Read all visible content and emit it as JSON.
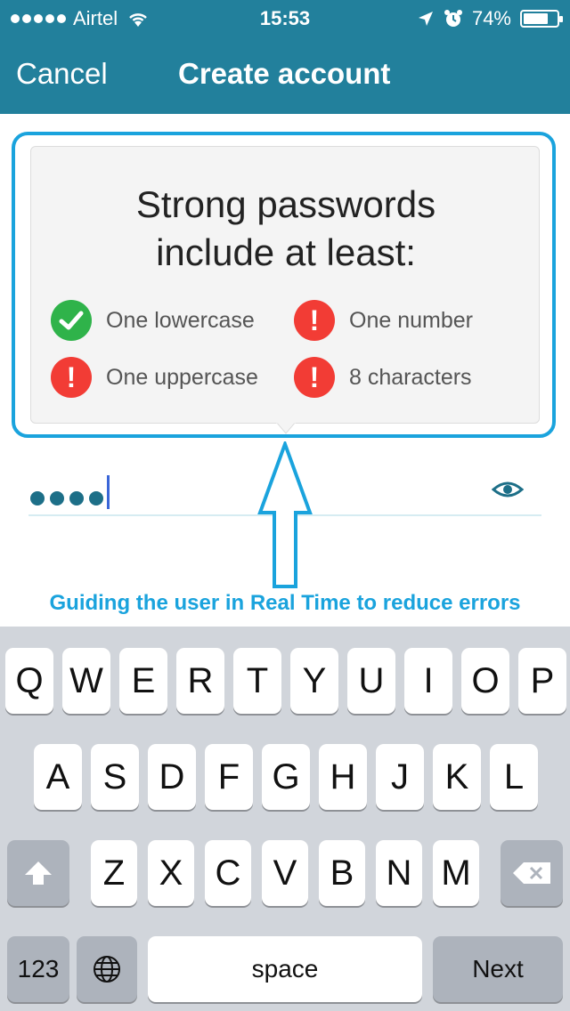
{
  "status_bar": {
    "carrier": "Airtel",
    "time": "15:53",
    "battery": "74%",
    "battery_level": 0.74,
    "icons": [
      "signal-dots-icon",
      "wifi-icon",
      "location-arrow-icon",
      "alarm-icon",
      "battery-icon"
    ]
  },
  "nav": {
    "cancel": "Cancel",
    "title": "Create account"
  },
  "password_tip": {
    "title_line1": "Strong passwords",
    "title_line2": "include at least:",
    "requirements": [
      {
        "label": "One lowercase",
        "met": true
      },
      {
        "label": "One number",
        "met": false
      },
      {
        "label": "One uppercase",
        "met": false
      },
      {
        "label": "8 characters",
        "met": false
      }
    ]
  },
  "password_field": {
    "masked_length": 4,
    "toggle_icon": "eye-icon"
  },
  "annotation": {
    "caption": "Guiding the user in Real Time to reduce errors",
    "color": "#1aa3dd"
  },
  "keyboard": {
    "row1": [
      "Q",
      "W",
      "E",
      "R",
      "T",
      "Y",
      "U",
      "I",
      "O",
      "P"
    ],
    "row2": [
      "A",
      "S",
      "D",
      "F",
      "G",
      "H",
      "J",
      "K",
      "L"
    ],
    "row3": [
      "Z",
      "X",
      "C",
      "V",
      "B",
      "N",
      "M"
    ],
    "numbers": "123",
    "space": "space",
    "next": "Next"
  },
  "colors": {
    "nav_bg": "#22809c",
    "success": "#2fb34a",
    "error": "#f23c35",
    "keyboard_bg": "#d1d5db"
  }
}
